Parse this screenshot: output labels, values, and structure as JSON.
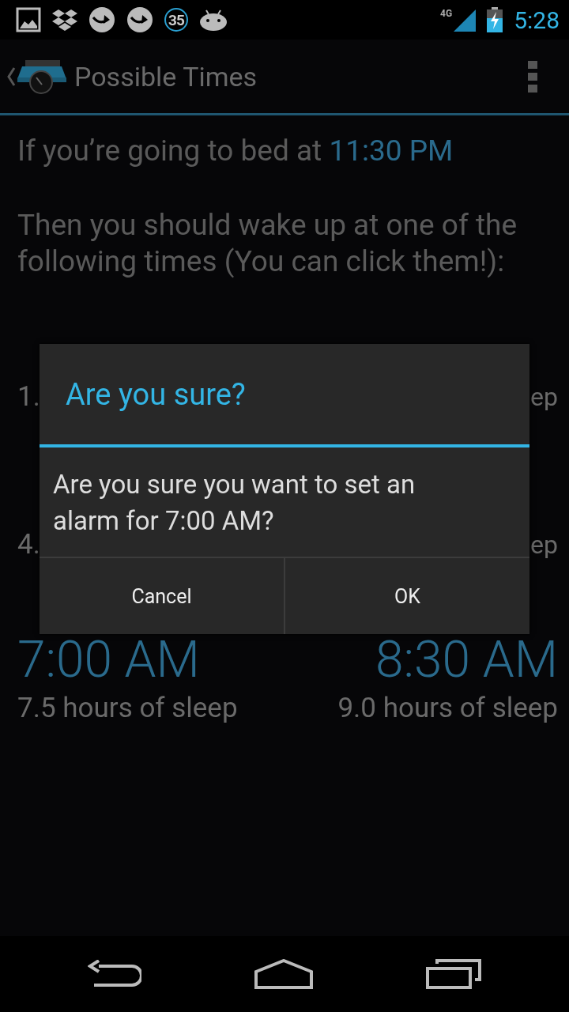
{
  "status_bar": {
    "time": "5:28",
    "badge": "35",
    "network": "4G"
  },
  "action_bar": {
    "title": "Possible Times"
  },
  "content": {
    "bedtime_text": "If you’re going to bed at",
    "bedtime_value": "11:30 PM",
    "instructions": "Then you should wake up at one of the following times (You can click them!):",
    "results": [
      {
        "hours": "1."
      },
      {
        "hours": "ep"
      },
      {
        "hours": "4."
      },
      {
        "hours": "ep"
      },
      {
        "time": "7:00 AM",
        "hours": "7.5 hours of sleep"
      },
      {
        "time": "8:30 AM",
        "hours": "9.0 hours of sleep"
      }
    ]
  },
  "dialog": {
    "title": "Are you sure?",
    "message": "Are you sure you want to set an alarm for 7:00 AM?",
    "buttons": [
      "Cancel",
      "OK"
    ]
  }
}
